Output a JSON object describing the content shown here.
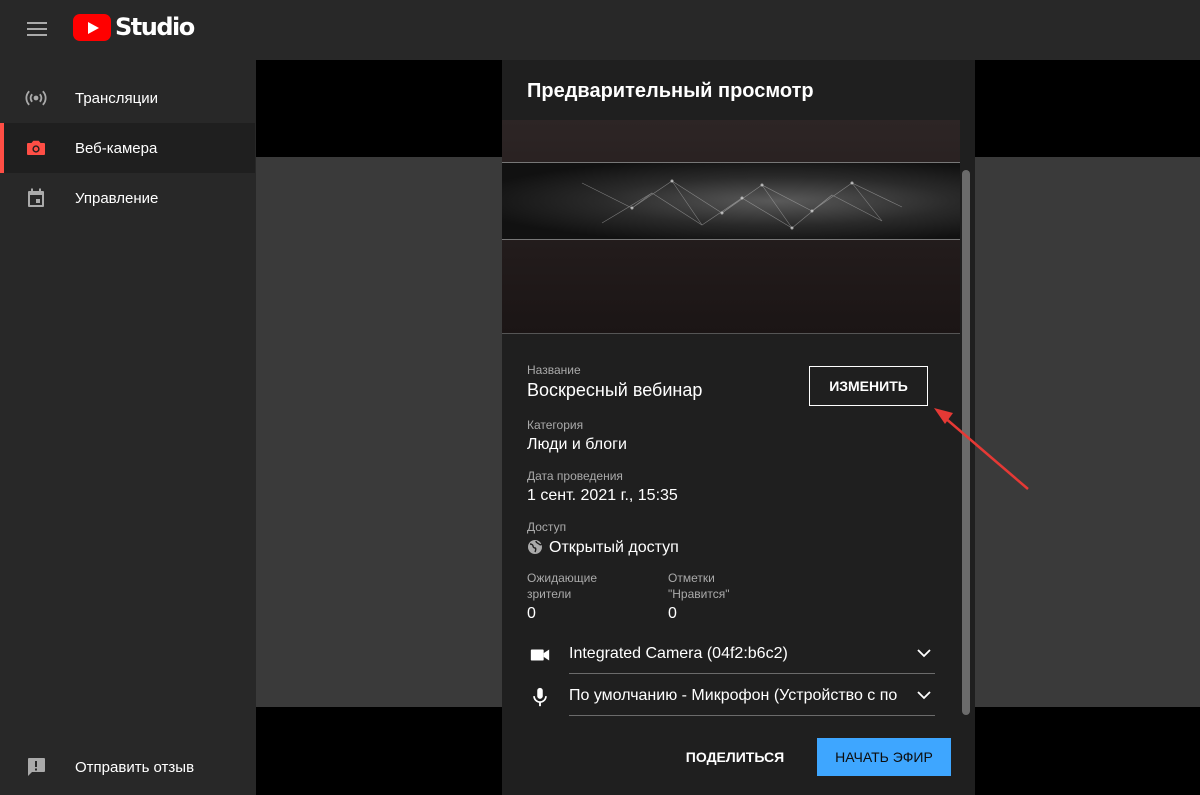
{
  "header": {
    "logo_text": "Studio"
  },
  "sidebar": {
    "items": [
      {
        "label": "Трансляции",
        "icon": "live-broadcast-icon"
      },
      {
        "label": "Веб-камера",
        "icon": "camera-icon",
        "active": true
      },
      {
        "label": "Управление",
        "icon": "calendar-icon"
      }
    ],
    "feedback_label": "Отправить отзыв"
  },
  "dialog": {
    "title": "Предварительный просмотр",
    "fields": {
      "title_label": "Название",
      "title_value": "Воскресный вебинар",
      "category_label": "Категория",
      "category_value": "Люди и блоги",
      "date_label": "Дата проведения",
      "date_value": "1 сент. 2021 г., 15:35",
      "access_label": "Доступ",
      "access_value": "Открытый доступ",
      "waiting_label_line1": "Ожидающие",
      "waiting_label_line2": "зрители",
      "waiting_value": "0",
      "likes_label_line1": "Отметки",
      "likes_label_line2": "\"Нравится\"",
      "likes_value": "0"
    },
    "edit_label": "ИЗМЕНИТЬ",
    "camera_device": "Integrated Camera (04f2:b6c2)",
    "mic_device": "По умолчанию - Микрофон (Устройство с по",
    "share_label": "ПОДЕЛИТЬСЯ",
    "start_label": "НАЧАТЬ ЭФИР"
  },
  "colors": {
    "accent_blue": "#3ea6ff",
    "brand_red": "#ff0000",
    "active_indicator": "#ff4e45",
    "annotation_arrow": "#e53935"
  }
}
